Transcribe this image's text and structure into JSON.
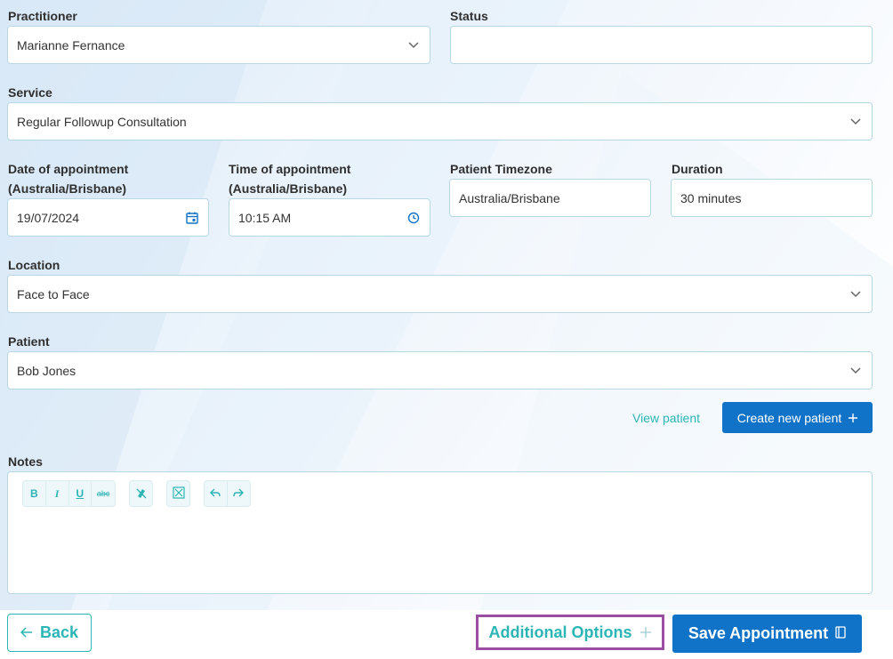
{
  "form": {
    "practitioner": {
      "label": "Practitioner",
      "value": "Marianne Fernance"
    },
    "status": {
      "label": "Status",
      "value": ""
    },
    "service": {
      "label": "Service",
      "value": "Regular Followup Consultation"
    },
    "date": {
      "label_line1": "Date of appointment",
      "label_line2": "(Australia/Brisbane)",
      "value": "19/07/2024"
    },
    "time": {
      "label_line1": "Time of appointment",
      "label_line2": "(Australia/Brisbane)",
      "value": "10:15 AM"
    },
    "timezone": {
      "label": "Patient Timezone",
      "value": "Australia/Brisbane"
    },
    "duration": {
      "label": "Duration",
      "value": "30 minutes"
    },
    "location": {
      "label": "Location",
      "value": "Face to Face"
    },
    "patient": {
      "label": "Patient",
      "value": "Bob Jones"
    },
    "view_patient": "View patient",
    "create_patient": "Create new patient",
    "notes": {
      "label": "Notes",
      "toolbar": {
        "bold": "B",
        "italic": "I",
        "underline": "U",
        "strike": "abc"
      }
    }
  },
  "footer": {
    "back": "Back",
    "additional_options": "Additional Options",
    "save": "Save Appointment"
  },
  "colors": {
    "accent_teal": "#2bb5b5",
    "primary_blue": "#1173c7",
    "highlight_purple": "#9b4fa3"
  },
  "icons": [
    "chevron-down-icon",
    "calendar-icon",
    "clock-icon",
    "plus-icon",
    "arrow-left-icon",
    "notebook-icon",
    "clear-format-icon",
    "fullscreen-icon",
    "undo-icon",
    "redo-icon"
  ]
}
